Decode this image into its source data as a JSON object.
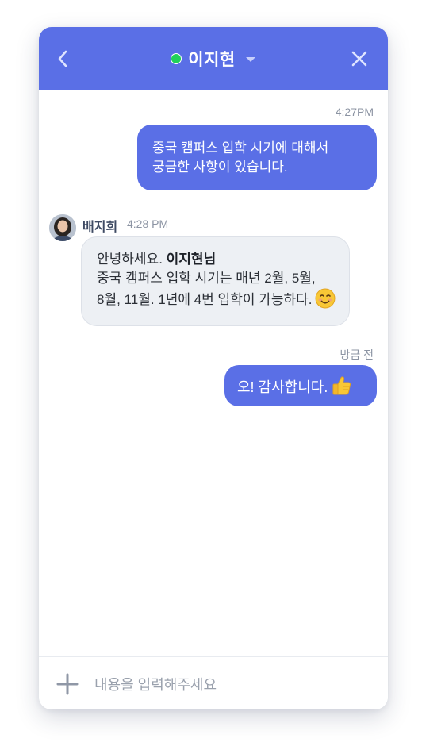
{
  "header": {
    "title": "이지현",
    "status": "online",
    "accent_color": "#5a6fe6",
    "online_color": "#21d05a"
  },
  "messages": [
    {
      "from": "me",
      "time": "4:27PM",
      "lines": [
        "중국 캠퍼스 입학 시기에 대해서",
        "궁금한 사항이 있습니다."
      ]
    },
    {
      "from": "other",
      "sender": "배지희",
      "time": "4:28 PM",
      "greeting": "안녕하세요. ",
      "mention": "이지현님",
      "lines": [
        "중국 캠퍼스 입학 시기는 매년 2월, 5월,",
        "8월, 11월. 1년에 4번 입학이 가능하다."
      ],
      "emoji": "smiling-face-icon"
    },
    {
      "from": "me",
      "time": "방금 전",
      "text": "오! 감사합니다.",
      "emoji": "thumbs-up-icon"
    }
  ],
  "composer": {
    "placeholder": "내용을 입력해주세요"
  }
}
